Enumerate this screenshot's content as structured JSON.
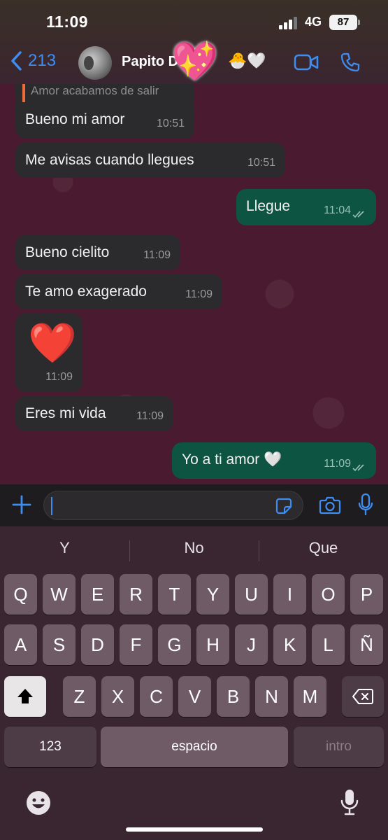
{
  "status": {
    "time": "11:09",
    "network": "4G",
    "battery": "87"
  },
  "header": {
    "back_count": "213",
    "contact_name": "Papito D",
    "name_emojis": "🐣🤍",
    "sticker": "💖"
  },
  "messages": {
    "reply_preview": "Amor acabamos de salir",
    "m1": {
      "text": "Bueno mi amor",
      "time": "10:51"
    },
    "m2": {
      "text": "Me avisas cuando llegues",
      "time": "10:51"
    },
    "m3": {
      "text": "Llegue",
      "time": "11:04"
    },
    "m4": {
      "text": "Bueno cielito",
      "time": "11:09"
    },
    "m5": {
      "text": "Te amo exagerado",
      "time": "11:09"
    },
    "m6": {
      "text": "❤️",
      "time": "11:09"
    },
    "m7": {
      "text": "Eres mi vida",
      "time": "11:09"
    },
    "m8": {
      "text": "Yo a ti amor 🤍",
      "time": "11:09"
    }
  },
  "keyboard": {
    "suggestions": [
      "Y",
      "No",
      "Que"
    ],
    "row1": [
      "Q",
      "W",
      "E",
      "R",
      "T",
      "Y",
      "U",
      "I",
      "O",
      "P"
    ],
    "row2": [
      "A",
      "S",
      "D",
      "F",
      "G",
      "H",
      "J",
      "K",
      "L",
      "Ñ"
    ],
    "row3": [
      "Z",
      "X",
      "C",
      "V",
      "B",
      "N",
      "M"
    ],
    "numbers_key": "123",
    "space_key": "espacio",
    "return_key": "intro"
  },
  "colors": {
    "accent": "#3d8ef0",
    "incoming_bubble": "#2b2b2d",
    "outgoing_bubble": "#0e5443",
    "chat_background": "#4a1a30"
  }
}
